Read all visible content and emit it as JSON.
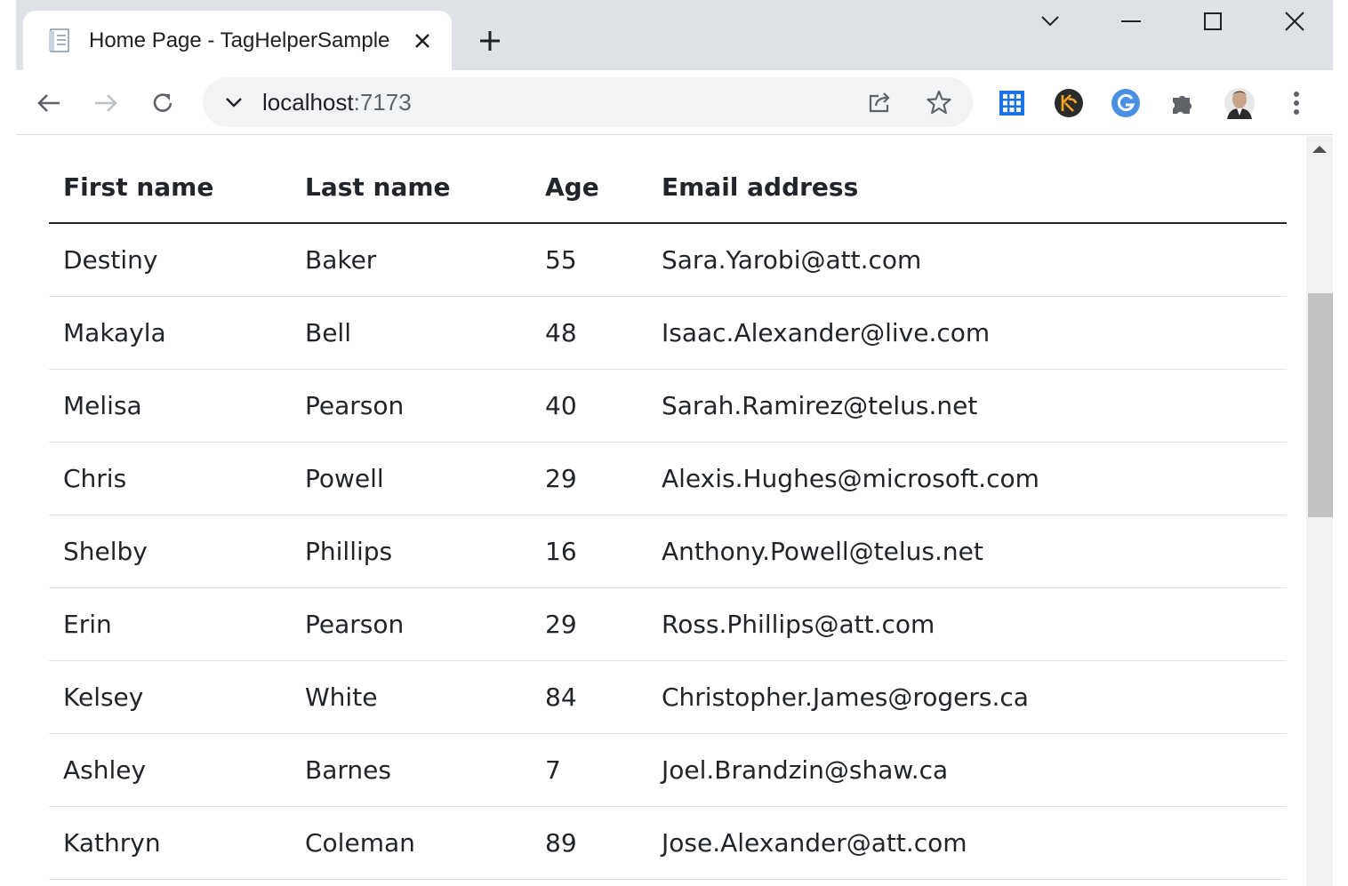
{
  "tab": {
    "title": "Home Page - TagHelperSample",
    "favicon": "page-document-icon"
  },
  "toolbar": {
    "url_host": "localhost",
    "url_port": ":7173",
    "extensions": [
      "apps-grid-icon",
      "keeper-icon",
      "grammarly-icon",
      "extensions-puzzle-icon",
      "profile-avatar"
    ]
  },
  "table": {
    "headers": [
      "First name",
      "Last name",
      "Age",
      "Email address"
    ],
    "rows": [
      [
        "Destiny",
        "Baker",
        "55",
        "Sara.Yarobi@att.com"
      ],
      [
        "Makayla",
        "Bell",
        "48",
        "Isaac.Alexander@live.com"
      ],
      [
        "Melisa",
        "Pearson",
        "40",
        "Sarah.Ramirez@telus.net"
      ],
      [
        "Chris",
        "Powell",
        "29",
        "Alexis.Hughes@microsoft.com"
      ],
      [
        "Shelby",
        "Phillips",
        "16",
        "Anthony.Powell@telus.net"
      ],
      [
        "Erin",
        "Pearson",
        "29",
        "Ross.Phillips@att.com"
      ],
      [
        "Kelsey",
        "White",
        "84",
        "Christopher.James@rogers.ca"
      ],
      [
        "Ashley",
        "Barnes",
        "7",
        "Joel.Brandzin@shaw.ca"
      ],
      [
        "Kathryn",
        "Coleman",
        "89",
        "Jose.Alexander@att.com"
      ]
    ]
  },
  "colors": {
    "tabstrip": "#dee1e6",
    "omnibox": "#f1f3f4",
    "text": "#212529",
    "row_border": "#dee2e6",
    "scroll_thumb": "#c1c1c1"
  }
}
